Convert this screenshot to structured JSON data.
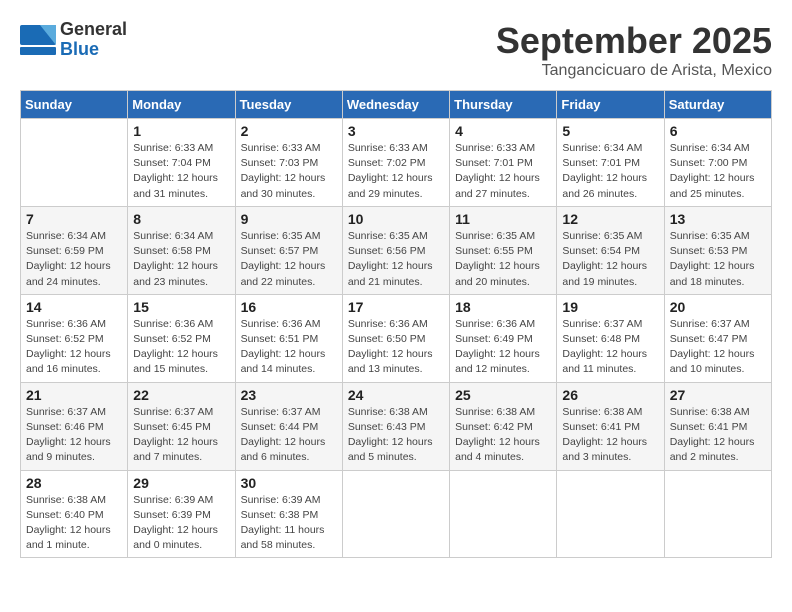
{
  "header": {
    "logo_general": "General",
    "logo_blue": "Blue",
    "title": "September 2025",
    "subtitle": "Tangancicuaro de Arista, Mexico"
  },
  "days_of_week": [
    "Sunday",
    "Monday",
    "Tuesday",
    "Wednesday",
    "Thursday",
    "Friday",
    "Saturday"
  ],
  "weeks": [
    [
      {
        "day": "",
        "info": ""
      },
      {
        "day": "1",
        "info": "Sunrise: 6:33 AM\nSunset: 7:04 PM\nDaylight: 12 hours\nand 31 minutes."
      },
      {
        "day": "2",
        "info": "Sunrise: 6:33 AM\nSunset: 7:03 PM\nDaylight: 12 hours\nand 30 minutes."
      },
      {
        "day": "3",
        "info": "Sunrise: 6:33 AM\nSunset: 7:02 PM\nDaylight: 12 hours\nand 29 minutes."
      },
      {
        "day": "4",
        "info": "Sunrise: 6:33 AM\nSunset: 7:01 PM\nDaylight: 12 hours\nand 27 minutes."
      },
      {
        "day": "5",
        "info": "Sunrise: 6:34 AM\nSunset: 7:01 PM\nDaylight: 12 hours\nand 26 minutes."
      },
      {
        "day": "6",
        "info": "Sunrise: 6:34 AM\nSunset: 7:00 PM\nDaylight: 12 hours\nand 25 minutes."
      }
    ],
    [
      {
        "day": "7",
        "info": "Sunrise: 6:34 AM\nSunset: 6:59 PM\nDaylight: 12 hours\nand 24 minutes."
      },
      {
        "day": "8",
        "info": "Sunrise: 6:34 AM\nSunset: 6:58 PM\nDaylight: 12 hours\nand 23 minutes."
      },
      {
        "day": "9",
        "info": "Sunrise: 6:35 AM\nSunset: 6:57 PM\nDaylight: 12 hours\nand 22 minutes."
      },
      {
        "day": "10",
        "info": "Sunrise: 6:35 AM\nSunset: 6:56 PM\nDaylight: 12 hours\nand 21 minutes."
      },
      {
        "day": "11",
        "info": "Sunrise: 6:35 AM\nSunset: 6:55 PM\nDaylight: 12 hours\nand 20 minutes."
      },
      {
        "day": "12",
        "info": "Sunrise: 6:35 AM\nSunset: 6:54 PM\nDaylight: 12 hours\nand 19 minutes."
      },
      {
        "day": "13",
        "info": "Sunrise: 6:35 AM\nSunset: 6:53 PM\nDaylight: 12 hours\nand 18 minutes."
      }
    ],
    [
      {
        "day": "14",
        "info": "Sunrise: 6:36 AM\nSunset: 6:52 PM\nDaylight: 12 hours\nand 16 minutes."
      },
      {
        "day": "15",
        "info": "Sunrise: 6:36 AM\nSunset: 6:52 PM\nDaylight: 12 hours\nand 15 minutes."
      },
      {
        "day": "16",
        "info": "Sunrise: 6:36 AM\nSunset: 6:51 PM\nDaylight: 12 hours\nand 14 minutes."
      },
      {
        "day": "17",
        "info": "Sunrise: 6:36 AM\nSunset: 6:50 PM\nDaylight: 12 hours\nand 13 minutes."
      },
      {
        "day": "18",
        "info": "Sunrise: 6:36 AM\nSunset: 6:49 PM\nDaylight: 12 hours\nand 12 minutes."
      },
      {
        "day": "19",
        "info": "Sunrise: 6:37 AM\nSunset: 6:48 PM\nDaylight: 12 hours\nand 11 minutes."
      },
      {
        "day": "20",
        "info": "Sunrise: 6:37 AM\nSunset: 6:47 PM\nDaylight: 12 hours\nand 10 minutes."
      }
    ],
    [
      {
        "day": "21",
        "info": "Sunrise: 6:37 AM\nSunset: 6:46 PM\nDaylight: 12 hours\nand 9 minutes."
      },
      {
        "day": "22",
        "info": "Sunrise: 6:37 AM\nSunset: 6:45 PM\nDaylight: 12 hours\nand 7 minutes."
      },
      {
        "day": "23",
        "info": "Sunrise: 6:37 AM\nSunset: 6:44 PM\nDaylight: 12 hours\nand 6 minutes."
      },
      {
        "day": "24",
        "info": "Sunrise: 6:38 AM\nSunset: 6:43 PM\nDaylight: 12 hours\nand 5 minutes."
      },
      {
        "day": "25",
        "info": "Sunrise: 6:38 AM\nSunset: 6:42 PM\nDaylight: 12 hours\nand 4 minutes."
      },
      {
        "day": "26",
        "info": "Sunrise: 6:38 AM\nSunset: 6:41 PM\nDaylight: 12 hours\nand 3 minutes."
      },
      {
        "day": "27",
        "info": "Sunrise: 6:38 AM\nSunset: 6:41 PM\nDaylight: 12 hours\nand 2 minutes."
      }
    ],
    [
      {
        "day": "28",
        "info": "Sunrise: 6:38 AM\nSunset: 6:40 PM\nDaylight: 12 hours\nand 1 minute."
      },
      {
        "day": "29",
        "info": "Sunrise: 6:39 AM\nSunset: 6:39 PM\nDaylight: 12 hours\nand 0 minutes."
      },
      {
        "day": "30",
        "info": "Sunrise: 6:39 AM\nSunset: 6:38 PM\nDaylight: 11 hours\nand 58 minutes."
      },
      {
        "day": "",
        "info": ""
      },
      {
        "day": "",
        "info": ""
      },
      {
        "day": "",
        "info": ""
      },
      {
        "day": "",
        "info": ""
      }
    ]
  ]
}
